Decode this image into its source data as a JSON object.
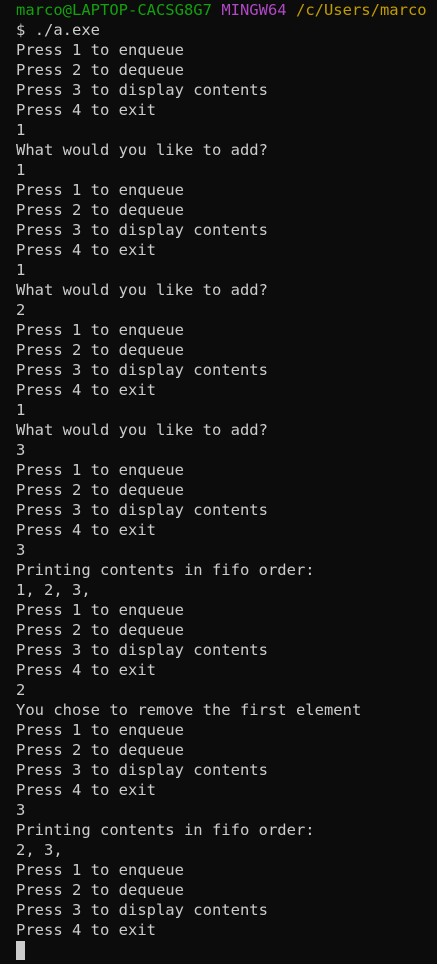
{
  "prompt": {
    "user_host": "marco@LAPTOP-CACSG8G7",
    "system": "MINGW64",
    "path": "/c/Users/marco",
    "symbol": "$",
    "command": "./a.exe"
  },
  "output_lines": [
    "Press 1 to enqueue",
    "Press 2 to dequeue",
    "Press 3 to display contents",
    "Press 4 to exit",
    "1",
    "What would you like to add?",
    "1",
    "Press 1 to enqueue",
    "Press 2 to dequeue",
    "Press 3 to display contents",
    "Press 4 to exit",
    "1",
    "What would you like to add?",
    "2",
    "Press 1 to enqueue",
    "Press 2 to dequeue",
    "Press 3 to display contents",
    "Press 4 to exit",
    "1",
    "What would you like to add?",
    "3",
    "Press 1 to enqueue",
    "Press 2 to dequeue",
    "Press 3 to display contents",
    "Press 4 to exit",
    "3",
    "Printing contents in fifo order:",
    "1, 2, 3,",
    "Press 1 to enqueue",
    "Press 2 to dequeue",
    "Press 3 to display contents",
    "Press 4 to exit",
    "2",
    "You chose to remove the first element",
    "Press 1 to enqueue",
    "Press 2 to dequeue",
    "Press 3 to display contents",
    "Press 4 to exit",
    "3",
    "Printing contents in fifo order:",
    "2, 3,",
    "Press 1 to enqueue",
    "Press 2 to dequeue",
    "Press 3 to display contents",
    "Press 4 to exit"
  ],
  "colors": {
    "background": "#0c0c0c",
    "text": "#cccccc",
    "user_host": "#13a10e",
    "system": "#b148c6",
    "path": "#c19c00"
  }
}
